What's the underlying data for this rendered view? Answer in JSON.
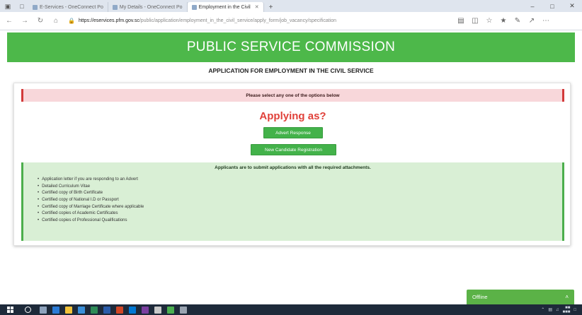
{
  "browser": {
    "tabs": [
      {
        "label": "E-Services - OneConnect Po"
      },
      {
        "label": "My Details - OneConnect Po"
      },
      {
        "label": "Employment in the Civil"
      }
    ],
    "url_host": "https://eservices.pfm.gov.sc",
    "url_path": "/public/application/employment_in_the_civil_service/apply_form/job_vacancy/specification",
    "new_tab": "+",
    "window": {
      "minimize": "–",
      "maximize": "□",
      "close": "✕"
    }
  },
  "page": {
    "header_title": "PUBLIC SERVICE COMMISSION",
    "subtitle": "APPLICATION FOR EMPLOYMENT IN THE CIVIL SERVICE",
    "alert_text": "Please select any one of the options below",
    "applying_as": "Applying as?",
    "buttons": {
      "advert": "Advert Response",
      "new_candidate": "New Candidate Registration"
    },
    "info_title": "Applicants are to submit applications with all the required attachments.",
    "requirements": [
      "Application letter if you are responding to an Advert",
      "Detailed Curriculum Vitae",
      "Certified copy of Birth Certificate",
      "Certified copy of National I.D or Passport",
      "Certified copy of Marriage Certificate where applicable",
      "Certified copies of Academic Certificates",
      "Certified copies of Professional Qualifications"
    ]
  },
  "offline_widget": {
    "label": "Offline",
    "chevron": "˄"
  },
  "colors": {
    "header_green": "#4db84a",
    "button_green": "#43b24a",
    "alert_red": "#d23a3a",
    "applying_red": "#e0413a",
    "info_bg": "#d9efd5"
  }
}
